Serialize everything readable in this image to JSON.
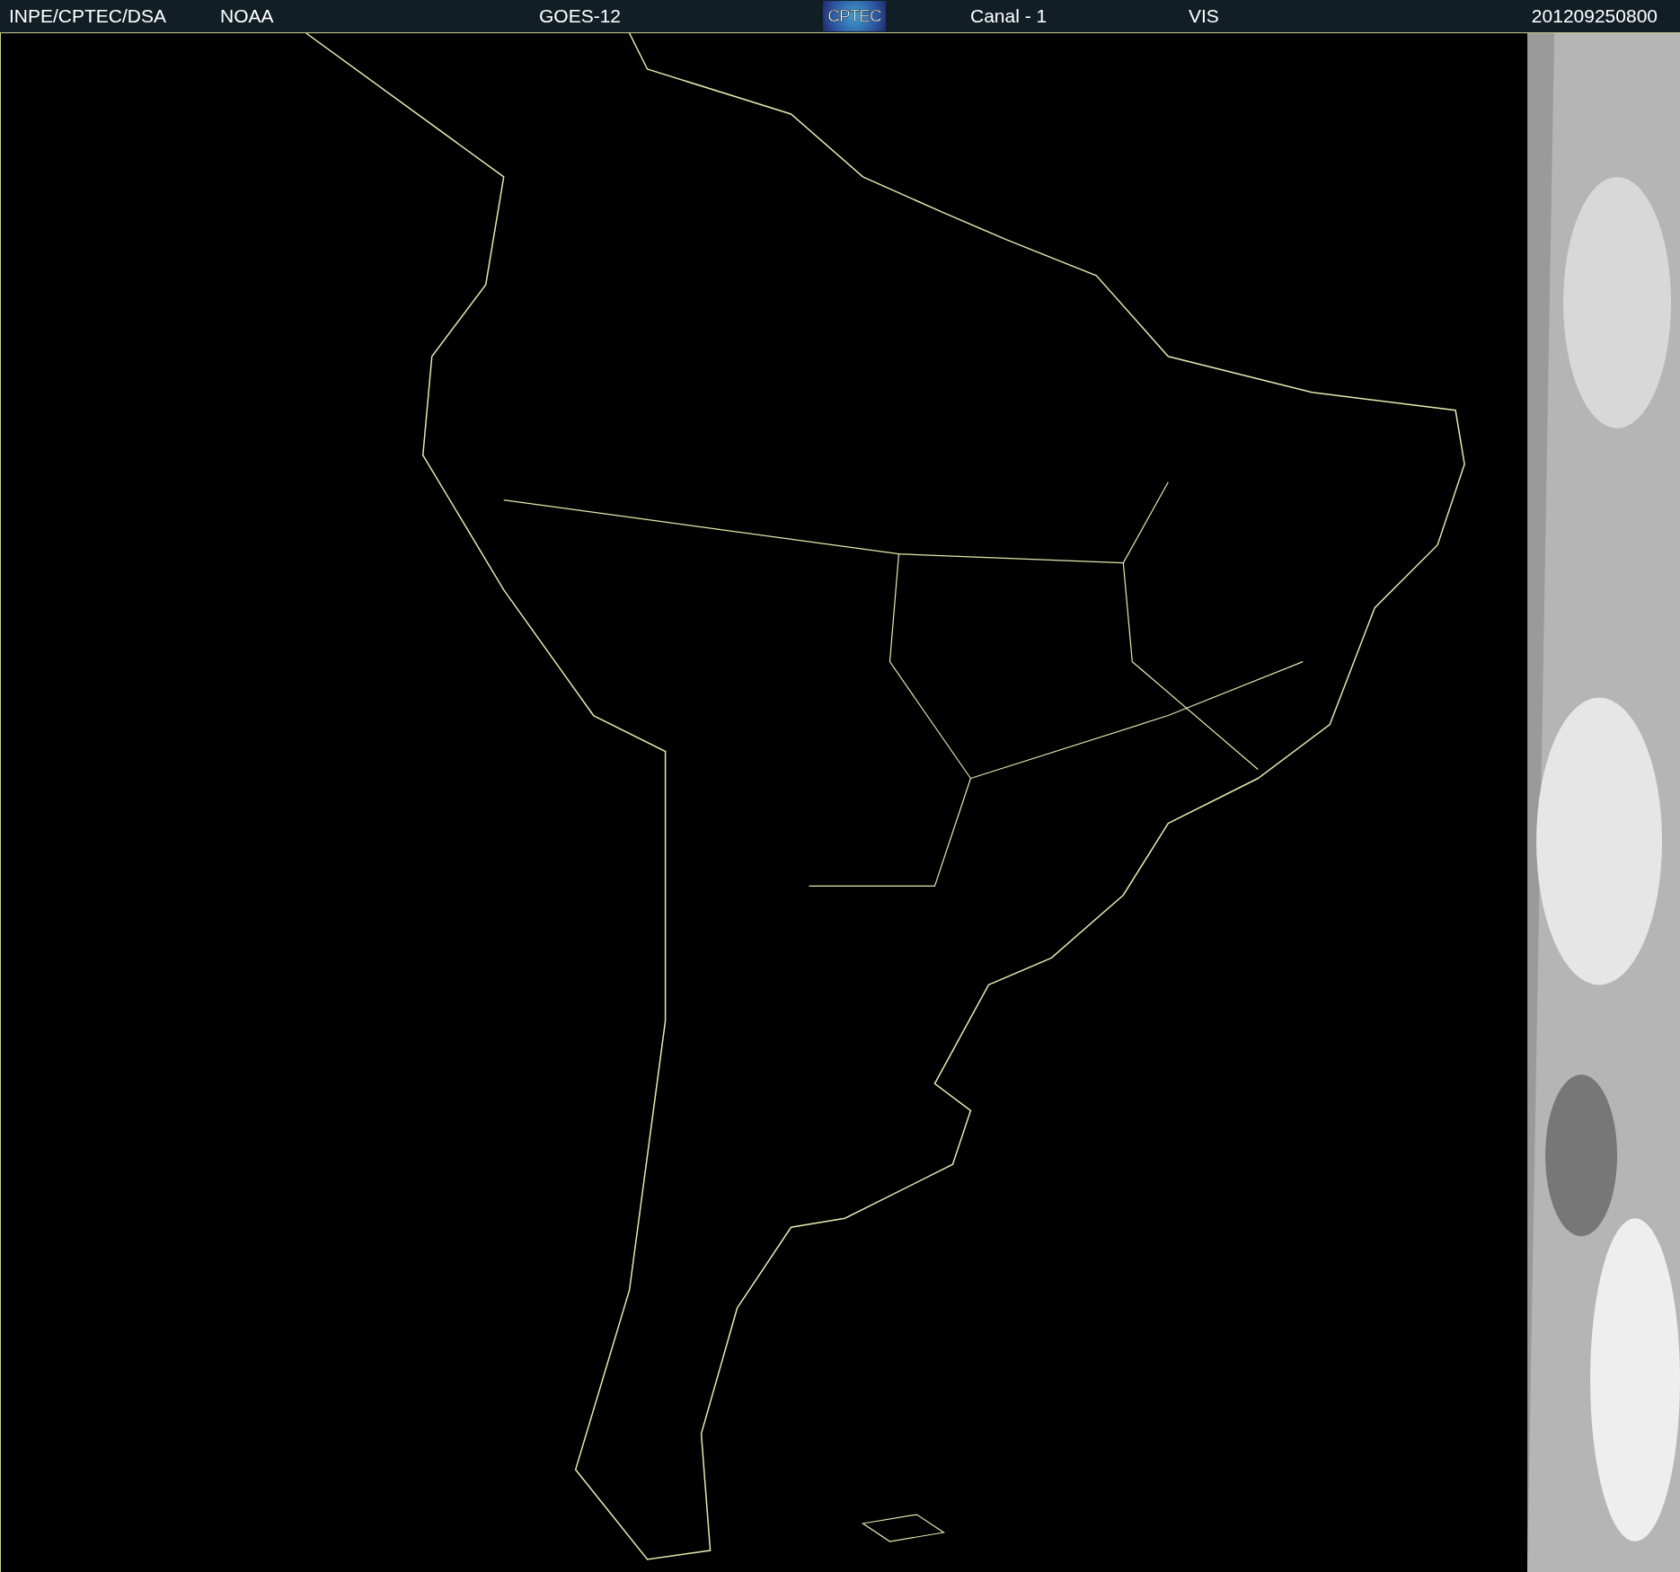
{
  "header": {
    "agency": "INPE/CPTEC/DSA",
    "source": "NOAA",
    "satellite": "GOES-12",
    "logo": "CPTEC",
    "channel": "Canal - 1",
    "band": "VIS",
    "timestamp": "201209250800"
  }
}
